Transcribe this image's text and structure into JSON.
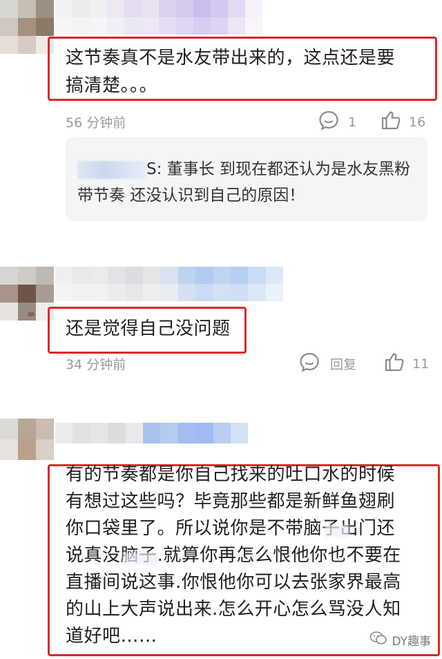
{
  "comments": [
    {
      "text_line1": "这节奏真不是水友带出来的，这点还是要",
      "text_line2": "搞清楚。。。",
      "time": "56 分钟前",
      "reply_count": "1",
      "like_count": "16",
      "reply": {
        "suffix_line1": "S: 董事长 到现在都还认为是水友黑粉",
        "line2": "带节奏 还没认识到自己的原因！"
      }
    },
    {
      "text": "还是觉得自己没问题",
      "time": "34 分钟前",
      "reply_label": "回复",
      "like_count": "11"
    },
    {
      "lines": [
        "有的节奏都是你自己找来的吐口水的时候",
        "有想过这些吗？毕竟那些都是新鲜鱼翅刷",
        "你口袋里了。所以说你是不带脑子出门还",
        "说真没脑子.就算你再怎么恨他你也不要在",
        "直播间说这事.你恨他你可以去张家界最高",
        "的山上大声说出来.怎么开心怎么骂没人知",
        "道好吧……"
      ]
    }
  ],
  "watermark": {
    "label": "DY趣事",
    "icon": "wechat-icon"
  },
  "colors": {
    "highlight": "#e0262a",
    "meta": "#9a9a9a",
    "reply_bg": "#f4f5f7"
  }
}
